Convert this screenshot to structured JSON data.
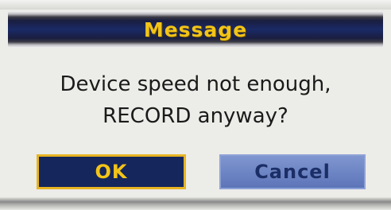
{
  "dialog": {
    "title": "Message",
    "message_line1": "Device speed not enough,",
    "message_line2": "RECORD anyway?",
    "ok_label": "OK",
    "cancel_label": "Cancel",
    "focused_button": "OK"
  },
  "colors": {
    "title_text": "#f2c418",
    "title_bar": "#1a2a66",
    "body_background": "#ecece8",
    "ok_button_background": "#15265c",
    "ok_button_border": "#e8b422",
    "cancel_button_background": "#6e86c4",
    "cancel_text": "#1c2e66"
  }
}
